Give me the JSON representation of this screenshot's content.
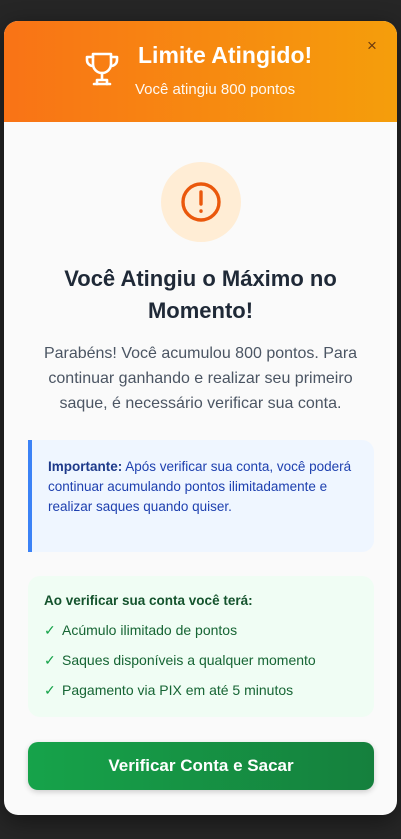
{
  "header": {
    "title": "Limite Atingido!",
    "subtitle": "Você atingiu 800 pontos",
    "close_label": "×",
    "trophy_icon": "trophy-icon"
  },
  "main": {
    "warning_icon": "exclamation-circle-icon",
    "headline": "Você Atingiu o Máximo no Momento!",
    "description": "Parabéns! Você acumulou 800 pontos. Para continuar ganhando e realizar seu primeiro saque, é necessário verificar sua conta."
  },
  "important": {
    "label": "Importante:",
    "text": " Após verificar sua conta, você poderá continuar acumulando pontos ilimitadamente e realizar saques quando quiser."
  },
  "benefits": {
    "title": "Ao verificar sua conta você terá:",
    "check_symbol": "✓",
    "items": [
      "Acúmulo ilimitado de pontos",
      "Saques disponíveis a qualquer momento",
      "Pagamento via PIX em até 5 minutos"
    ]
  },
  "cta": {
    "label": "Verificar Conta e Sacar"
  },
  "colors": {
    "header_gradient_start": "#f97316",
    "header_gradient_end": "#f59e0b",
    "warning_orange": "#ea580c",
    "cta_green": "#16a34a",
    "info_blue": "#3b82f6"
  }
}
